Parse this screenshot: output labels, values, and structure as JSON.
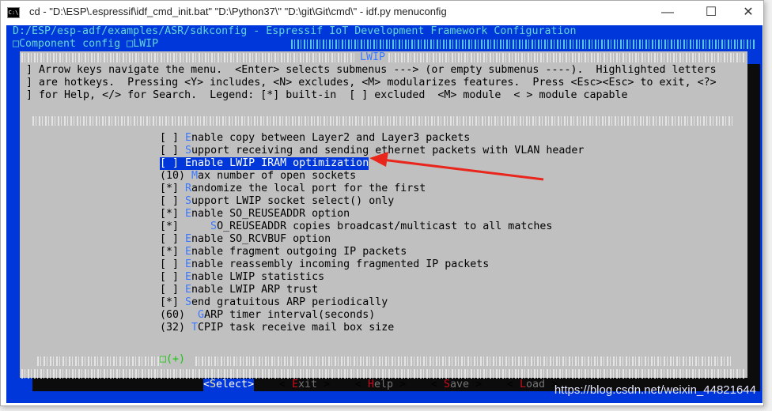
{
  "window": {
    "title": "cd - \"D:\\ESP\\.espressif\\idf_cmd_init.bat\"  \"D:\\Python37\\\" \"D:\\git\\Git\\cmd\\\" - idf.py  menuconfig",
    "icon": "cmd-icon",
    "minimize": "—",
    "maximize": "☐",
    "close": "✕"
  },
  "header": {
    "path": "D:/ESP/esp-adf/examples/ASR/sdkconfig - Espressif IoT Development Framework Configuration",
    "breadcrumb_1": "Component config",
    "breadcrumb_2": "LWIP"
  },
  "dialog": {
    "title": "LWIP",
    "help_lines": [
      "Arrow keys navigate the menu.  <Enter> selects submenus ---> (or empty submenus ----).  Highlighted letters",
      "are hotkeys.  Pressing <Y> includes, <N> excludes, <M> modularizes features.  Press <Esc><Esc> to exit, <?>",
      "for Help, </> for Search.  Legend: [*] built-in  [ ] excluded  <M> module  < > module capable"
    ],
    "items": [
      {
        "prefix": "[ ] ",
        "hot": "E",
        "rest": "nable copy between Layer2 and Layer3 packets"
      },
      {
        "prefix": "[ ] ",
        "hot": "S",
        "rest": "upport receiving and sending ethernet packets with VLAN header"
      },
      {
        "prefix": "[ ] ",
        "hot": "E",
        "rest": "nable LWIP IRAM optimization",
        "selected": true
      },
      {
        "prefix": "(10) ",
        "hot": "M",
        "rest": "ax number of open sockets"
      },
      {
        "prefix": "[*] ",
        "hot": "R",
        "rest": "andomize the local port for the first"
      },
      {
        "prefix": "[ ] ",
        "hot": "S",
        "rest": "upport LWIP socket select() only"
      },
      {
        "prefix": "[*] ",
        "hot": "E",
        "rest": "nable SO_REUSEADDR option"
      },
      {
        "prefix": "[*]     ",
        "hot": "S",
        "rest": "O_REUSEADDR copies broadcast/multicast to all matches"
      },
      {
        "prefix": "[ ] ",
        "hot": "E",
        "rest": "nable SO_RCVBUF option"
      },
      {
        "prefix": "[*] ",
        "hot": "E",
        "rest": "nable fragment outgoing IP packets"
      },
      {
        "prefix": "[ ] ",
        "hot": "E",
        "rest": "nable reassembly incoming fragmented IP packets"
      },
      {
        "prefix": "[ ] ",
        "hot": "E",
        "rest": "nable LWIP statistics"
      },
      {
        "prefix": "[ ] ",
        "hot": "E",
        "rest": "nable LWIP ARP trust"
      },
      {
        "prefix": "[*] ",
        "hot": "S",
        "rest": "end gratuitous ARP periodically"
      },
      {
        "prefix": "(60)  ",
        "hot": "G",
        "rest": "ARP timer interval(seconds)"
      },
      {
        "prefix": "(32) ",
        "hot": "T",
        "rest": "CPIP task receive mail box size"
      }
    ],
    "more_indicator": "(+)",
    "buttons": [
      {
        "open": "<",
        "hot": "S",
        "rest": "elect",
        "close": ">",
        "selected": true
      },
      {
        "open": "< ",
        "hot": "E",
        "rest": "xit",
        "close": " >"
      },
      {
        "open": "< ",
        "hot": "H",
        "rest": "elp",
        "close": " >"
      },
      {
        "open": "< ",
        "hot": "S",
        "rest": "ave",
        "close": " >"
      },
      {
        "open": "< ",
        "hot": "L",
        "rest": "oad",
        "close": " >"
      }
    ]
  },
  "watermark": "https://blog.csdn.net/weixin_44821644",
  "colors": {
    "terminal_bg": "#0037da",
    "dialog_bg": "#c0c0c0",
    "hotkey": "#3b78ff",
    "arrow": "#e8261c"
  }
}
